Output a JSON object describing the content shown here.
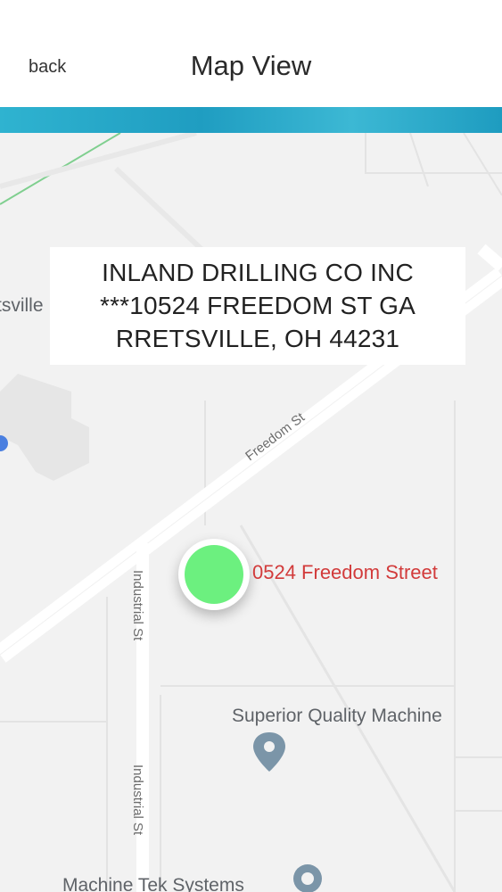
{
  "header": {
    "back_label": "back",
    "title": "Map View"
  },
  "info_card": {
    "line1": "INLAND DRILLING CO INC",
    "line2": "***10524 FREEDOM ST GA",
    "line3": "RRETSVILLE, OH 44231"
  },
  "map": {
    "marker_label": "0524 Freedom Street",
    "roads": {
      "freedom_st": "Freedom St",
      "industrial_st_upper": "Industrial St",
      "industrial_st_lower": "Industrial St"
    },
    "places": {
      "superior": "Superior Quality Machine",
      "machine_tek": "Machine Tek Systems",
      "left_edge": "tsville"
    },
    "colors": {
      "marker": "#6cf07f",
      "marker_label": "#d23b3b",
      "accent": "#1f9dc1"
    }
  }
}
